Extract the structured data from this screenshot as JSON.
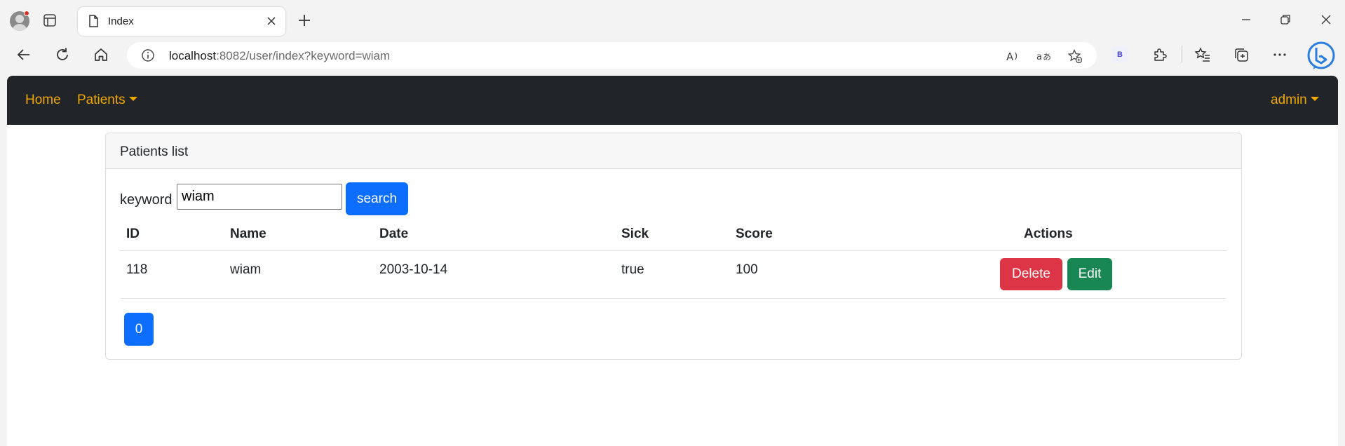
{
  "browser": {
    "tab_title": "Index",
    "url_host": "localhost",
    "url_rest": ":8082/user/index?keyword=wiam",
    "extension_badge": "B"
  },
  "navbar": {
    "home": "Home",
    "patients": "Patients",
    "user": "admin",
    "accent_color": "#f0a800",
    "background": "#212529"
  },
  "card": {
    "title": "Patients list"
  },
  "search": {
    "label": "keyword",
    "value": "wiam",
    "button": "search"
  },
  "table": {
    "headers": [
      "ID",
      "Name",
      "Date",
      "Sick",
      "Score",
      "Actions"
    ],
    "rows": [
      {
        "id": "118",
        "name": "wiam",
        "date": "2003-10-14",
        "sick": "true",
        "score": "100"
      }
    ],
    "delete_label": "Delete",
    "edit_label": "Edit"
  },
  "pagination": {
    "pages": [
      "0"
    ]
  }
}
